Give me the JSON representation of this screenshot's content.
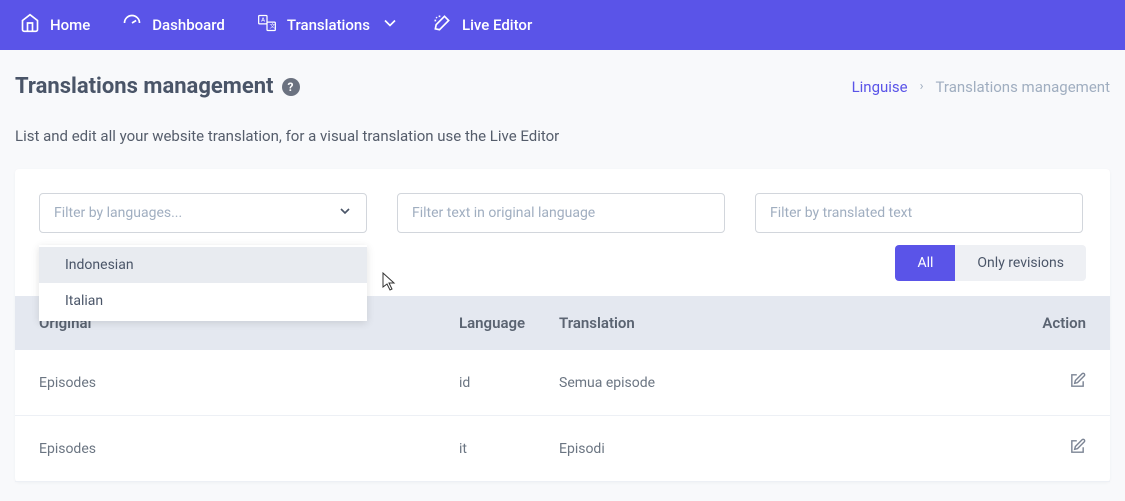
{
  "nav": {
    "items": [
      {
        "label": "Home"
      },
      {
        "label": "Dashboard"
      },
      {
        "label": "Translations"
      },
      {
        "label": "Live Editor"
      }
    ]
  },
  "page": {
    "title": "Translations management",
    "subtitle": "List and edit all your website translation, for a visual translation use the Live Editor"
  },
  "breadcrumb": {
    "link": "Linguise",
    "current": "Translations management"
  },
  "filters": {
    "language_placeholder": "Filter by languages...",
    "original_placeholder": "Filter text in original language",
    "translated_placeholder": "Filter by translated text",
    "dropdown": [
      "Indonesian",
      "Italian"
    ]
  },
  "toggle": {
    "all": "All",
    "revisions": "Only revisions"
  },
  "table": {
    "headers": {
      "original": "Original",
      "language": "Language",
      "translation": "Translation",
      "action": "Action"
    },
    "rows": [
      {
        "original": "Episodes",
        "lang": "id",
        "translation": "Semua episode"
      },
      {
        "original": "Episodes",
        "lang": "it",
        "translation": "Episodi"
      }
    ]
  }
}
